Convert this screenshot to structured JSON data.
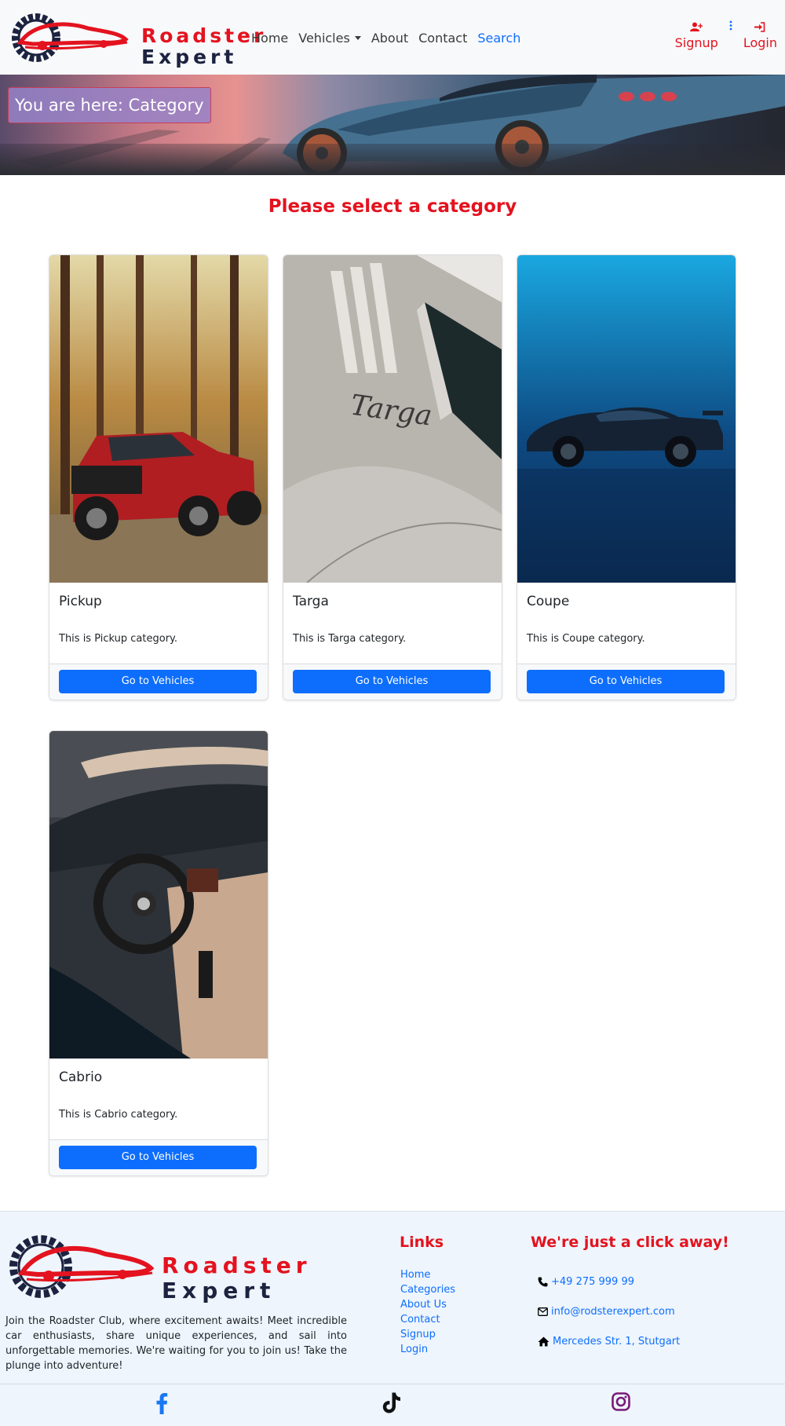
{
  "brand": {
    "name_line1": "Roadster",
    "name_line2": "Expert"
  },
  "nav": {
    "items": [
      {
        "label": "Home"
      },
      {
        "label": "Vehicles"
      },
      {
        "label": "About"
      },
      {
        "label": "Contact"
      },
      {
        "label": "Search"
      }
    ],
    "signup_label": "Signup",
    "login_label": "Login"
  },
  "hero": {
    "breadcrumb": "You are here: Category"
  },
  "main": {
    "title": "Please select a category",
    "cards": [
      {
        "title": "Pickup",
        "text": "This is Pickup category.",
        "button": "Go to Vehicles"
      },
      {
        "title": "Targa",
        "text": "This is Targa category.",
        "button": "Go to Vehicles"
      },
      {
        "title": "Coupe",
        "text": "This is Coupe category.",
        "button": "Go to Vehicles"
      },
      {
        "title": "Cabrio",
        "text": "This is Cabrio category.",
        "button": "Go to Vehicles"
      }
    ]
  },
  "footer": {
    "about": "Join the Roadster Club, where excitement awaits! Meet incredible car enthusiasts, share unique experiences, and sail into unforgettable memories. We're waiting for you to join us! Take the plunge into adventure!",
    "links_heading": "Links",
    "links": [
      "Home",
      "Categories",
      "About Us",
      "Contact",
      "Signup",
      "Login"
    ],
    "contact_heading": "We're just a click away!",
    "phone": "+49 275 999 99",
    "email": "info@rodsterexpert.com",
    "address": "Mercedes Str. 1, Stutgart"
  },
  "colors": {
    "brand_red": "#e3131f",
    "primary_blue": "#0d6efd",
    "brand_navy": "#1c2340"
  }
}
